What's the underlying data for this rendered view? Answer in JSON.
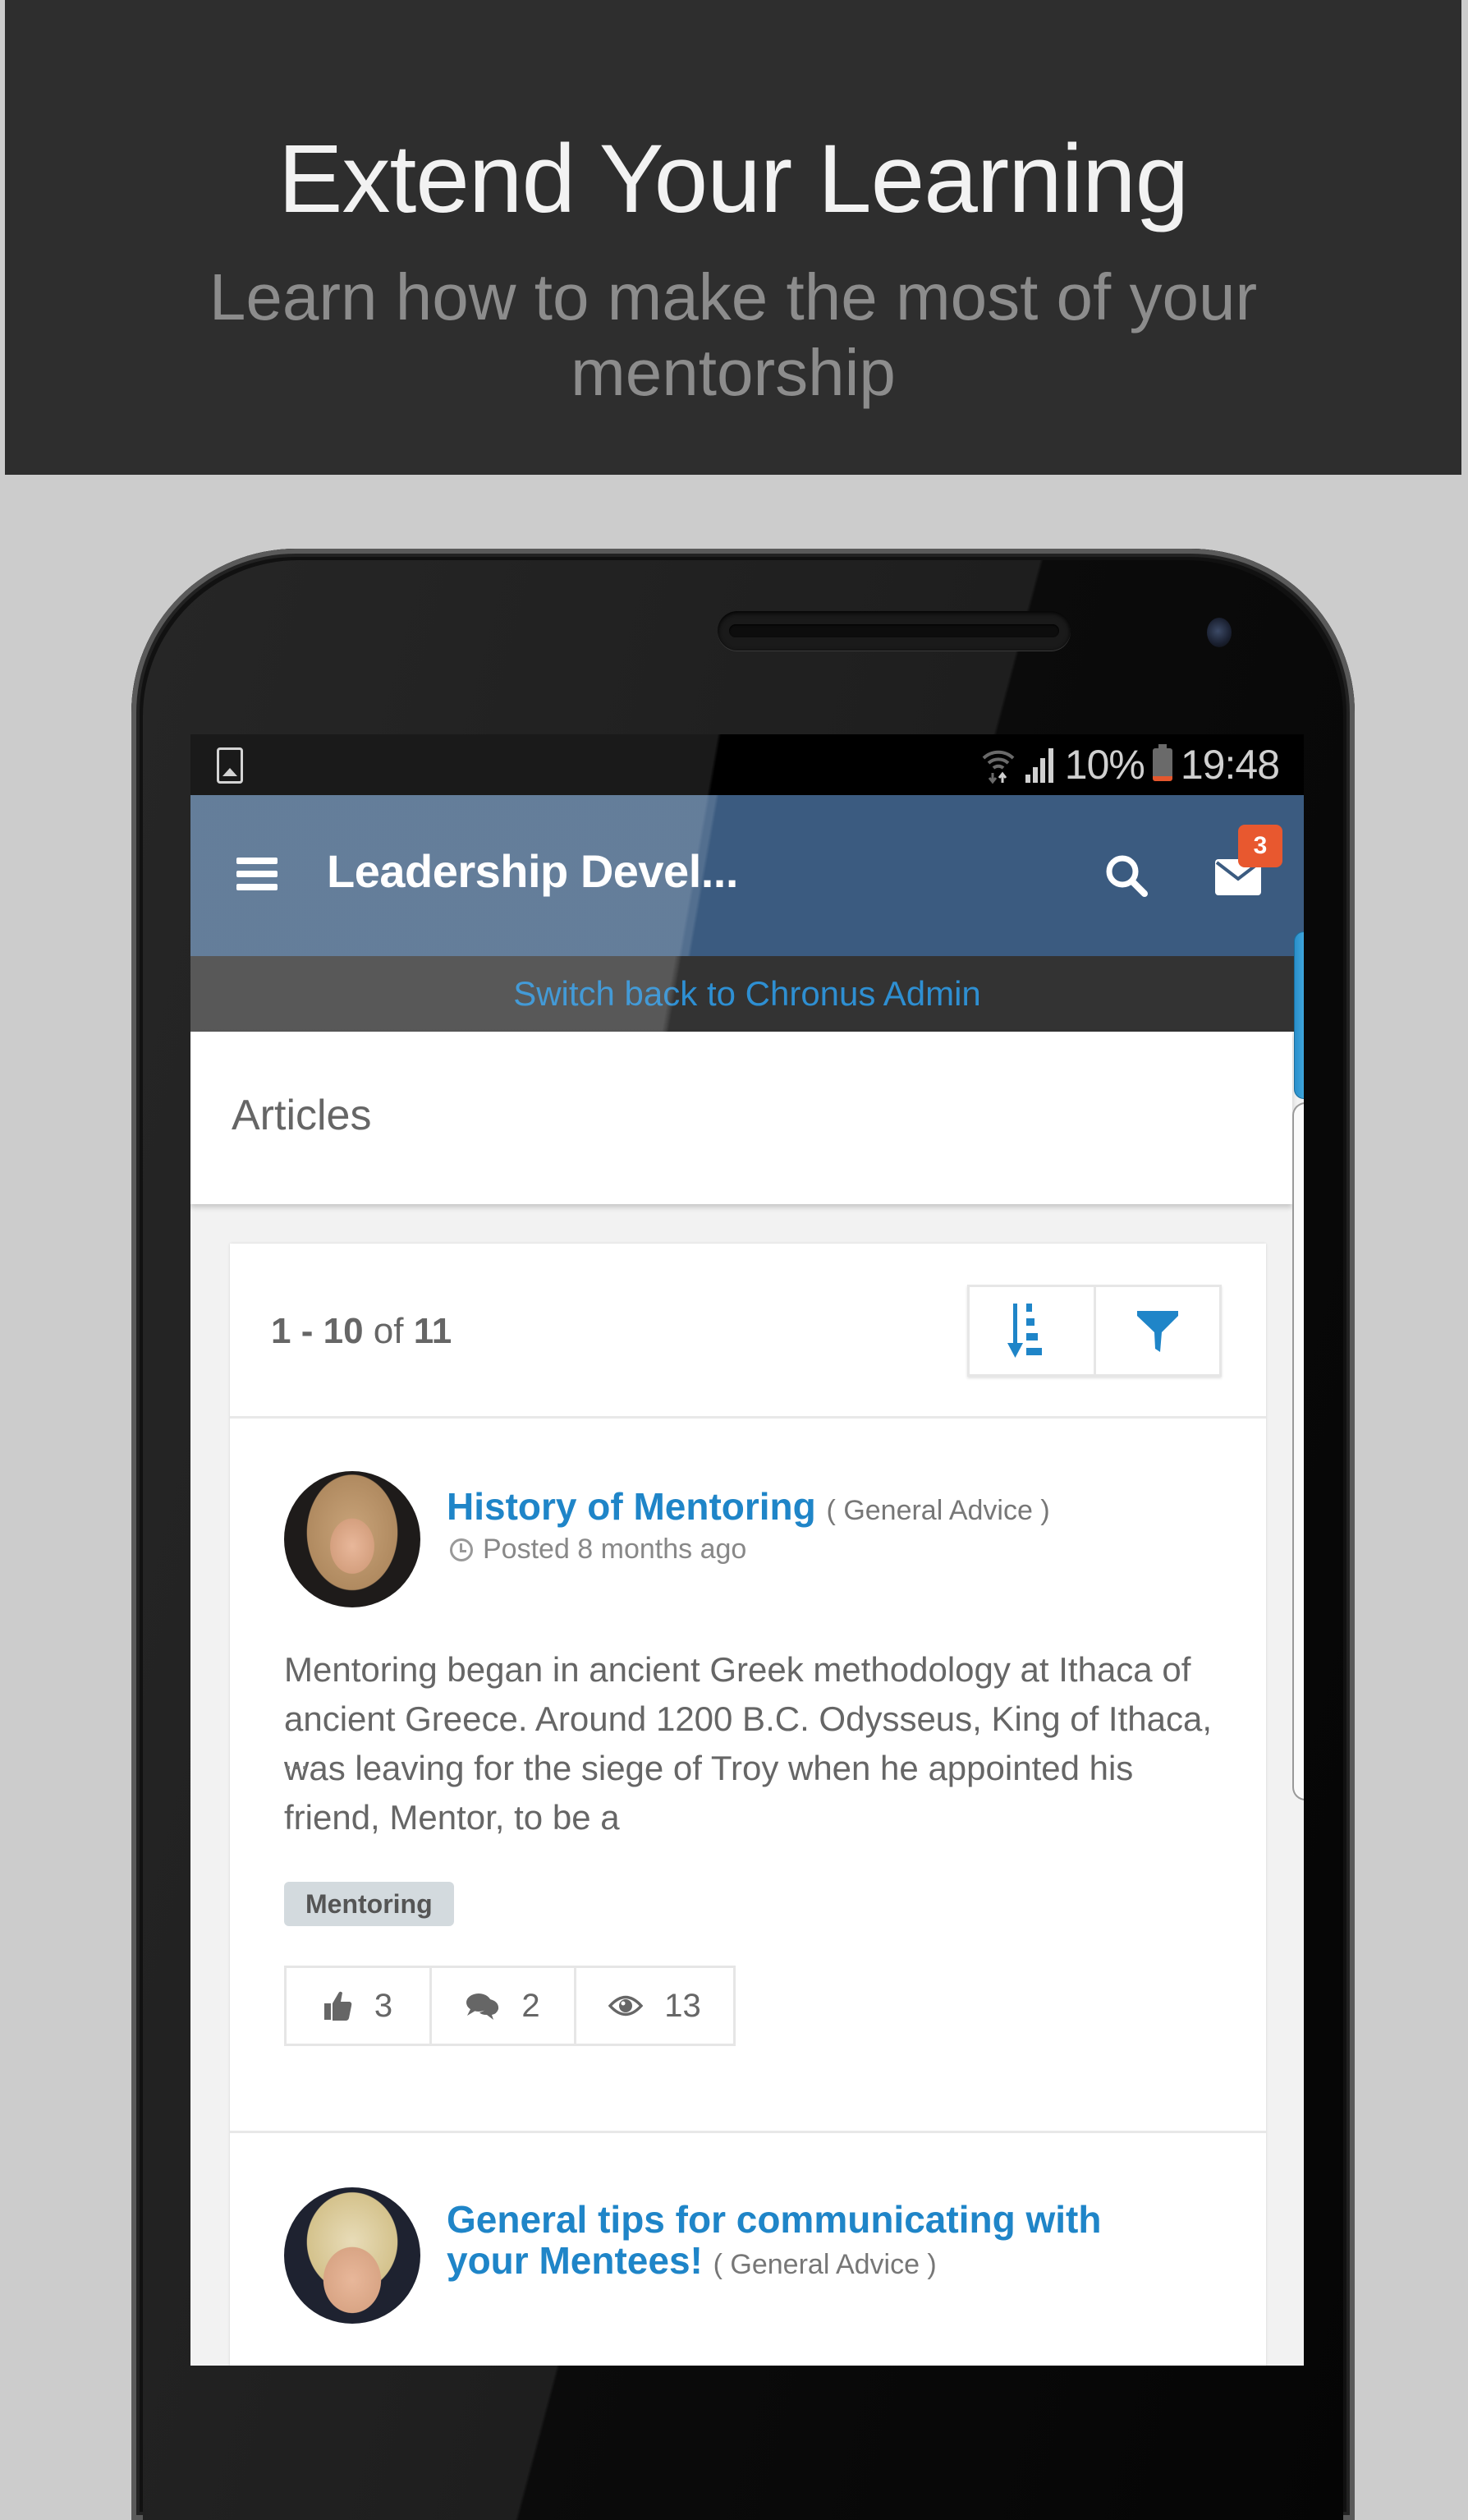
{
  "promo": {
    "title": "Extend Your Learning",
    "subtitle": "Learn how to make the most of your mentorship"
  },
  "status_bar": {
    "battery": "10%",
    "time": "19:48",
    "icons": [
      "gallery-notification-icon",
      "wifi-icon",
      "signal-icon",
      "battery-icon"
    ]
  },
  "app_bar": {
    "title": "Leadership Devel...",
    "menu_icon": "hamburger-menu-icon",
    "search_icon": "search-icon",
    "mail_icon": "mail-icon",
    "unread_count": "3",
    "badge_color": "#e8582f",
    "bar_color": "#3b5b80"
  },
  "switch_bar": {
    "link_label": "Switch back to Chronus Admin",
    "link_color": "#2e8fd2"
  },
  "page": {
    "title": "Articles"
  },
  "list": {
    "range_start": "1",
    "range_end": "10",
    "of_label": "of",
    "total": "11",
    "sort_icon": "sort-descending-icon",
    "filter_icon": "filter-icon"
  },
  "articles": [
    {
      "title": "History of Mentoring",
      "category": "( General Advice )",
      "posted": "Posted 8 months ago",
      "excerpt": "Mentoring began in ancient Greek methodology at Ithaca of ancient Greece. Around 1200 B.C. Odysseus, King of Ithaca, was leaving for the siege of Troy when he appointed his friend, Mentor, to be a",
      "ellipsis": "...",
      "tag": "Mentoring",
      "likes": "3",
      "comments": "2",
      "views": "13"
    },
    {
      "title": "General tips for communicating with your Mentees!",
      "category": "( General Advice )"
    }
  ],
  "colors": {
    "accent": "#1f85c8",
    "promo_bg": "#2e2e2e",
    "page_bg": "#cccccc"
  }
}
